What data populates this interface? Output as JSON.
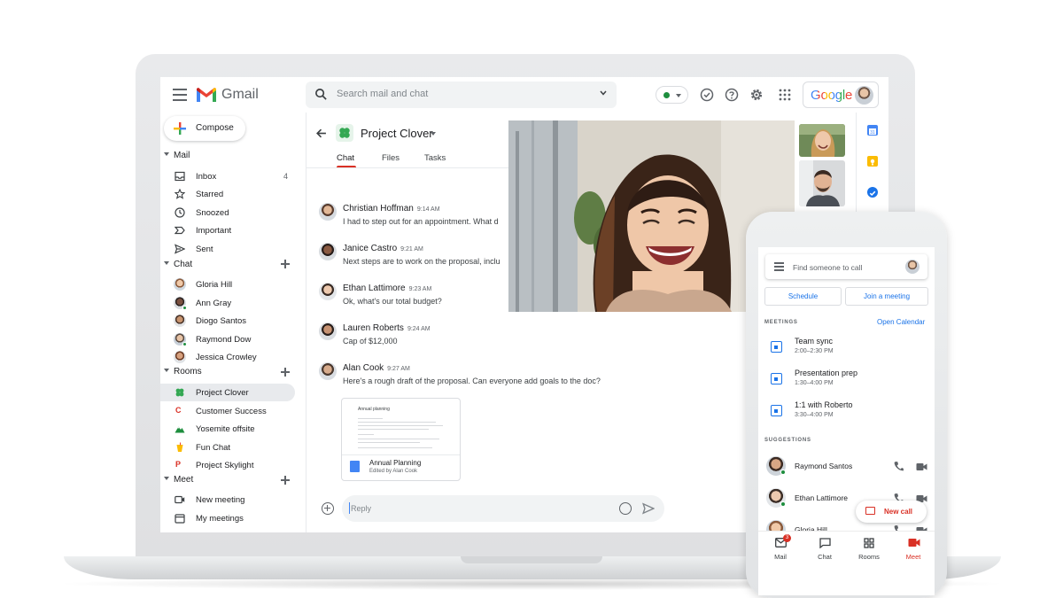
{
  "gmail": {
    "brand": "Gmail",
    "search_placeholder": "Search mail and chat",
    "google_label": "Google",
    "compose_label": "Compose",
    "mail_section": "Mail",
    "mail_items": [
      {
        "label": "Inbox",
        "count": "4"
      },
      {
        "label": "Starred"
      },
      {
        "label": "Snoozed"
      },
      {
        "label": "Important"
      },
      {
        "label": "Sent"
      }
    ],
    "chat_section": "Chat",
    "chat_items": [
      {
        "label": "Gloria Hill"
      },
      {
        "label": "Ann Gray"
      },
      {
        "label": "Diogo Santos"
      },
      {
        "label": "Raymond Dow"
      },
      {
        "label": "Jessica Crowley"
      }
    ],
    "rooms_section": "Rooms",
    "room_items": [
      {
        "label": "Project Clover"
      },
      {
        "label": "Customer Success",
        "letter": "C"
      },
      {
        "label": "Yosemite offsite"
      },
      {
        "label": "Fun Chat"
      },
      {
        "label": "Project Skylight",
        "letter": "P"
      }
    ],
    "meet_section": "Meet",
    "meet_items": [
      {
        "label": "New meeting"
      },
      {
        "label": "My meetings"
      }
    ]
  },
  "room": {
    "title": "Project Clover",
    "tabs": [
      "Chat",
      "Files",
      "Tasks"
    ],
    "active_tab": "Chat",
    "messages": [
      {
        "name": "Christian Hoffman",
        "time": "9:14 AM",
        "text": "I had to step out for an appointment. What d"
      },
      {
        "name": "Janice Castro",
        "time": "9:21 AM",
        "text": "Next steps are to work on the proposal, inclu"
      },
      {
        "name": "Ethan Lattimore",
        "time": "9:23 AM",
        "text": "Ok, what's our total budget?"
      },
      {
        "name": "Lauren Roberts",
        "time": "9:24 AM",
        "text": "Cap of $12,000"
      },
      {
        "name": "Alan Cook",
        "time": "9:27 AM",
        "text": "Here's a rough draft of the proposal. Can everyone add goals to the doc?"
      }
    ],
    "attachment": {
      "preview_title": "Annual planning",
      "title": "Annual Planning",
      "subtitle": "Edited by Alan Cook"
    },
    "reply_placeholder": "Reply"
  },
  "phone": {
    "search_placeholder": "Find someone to call",
    "schedule_label": "Schedule",
    "join_label": "Join a meeting",
    "meetings_heading": "MEETINGS",
    "open_calendar": "Open Calendar",
    "meetings": [
      {
        "title": "Team sync",
        "time": "2:00–2:30 PM"
      },
      {
        "title": "Presentation prep",
        "time": "1:30–4:00 PM"
      },
      {
        "title": "1:1 with Roberto",
        "time": "3:30–4:00 PM"
      }
    ],
    "suggestions_heading": "SUGGESTIONS",
    "suggestions": [
      {
        "name": "Raymond Santos"
      },
      {
        "name": "Ethan Lattimore"
      },
      {
        "name": "Gloria Hill"
      }
    ],
    "new_call_label": "New call",
    "nav": [
      {
        "label": "Mail",
        "badge": "3"
      },
      {
        "label": "Chat"
      },
      {
        "label": "Rooms"
      },
      {
        "label": "Meet"
      }
    ],
    "active_nav": "Meet"
  },
  "colors": {
    "accent_red": "#d93025",
    "accent_blue": "#1a73e8",
    "presence_green": "#1e8e3e"
  }
}
